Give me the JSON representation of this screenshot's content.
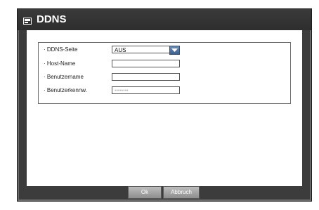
{
  "window": {
    "title": "DDNS"
  },
  "form": {
    "rows": [
      {
        "label": "· DDNS-Seite",
        "value": "AUS"
      },
      {
        "label": "· Host-Name",
        "value": ""
      },
      {
        "label": "· Benutzername",
        "value": ""
      },
      {
        "label": "· Benutzerkennw.",
        "value": "••••••••"
      }
    ]
  },
  "buttons": {
    "ok_label": "Ok",
    "cancel_label": "Abbruch"
  }
}
